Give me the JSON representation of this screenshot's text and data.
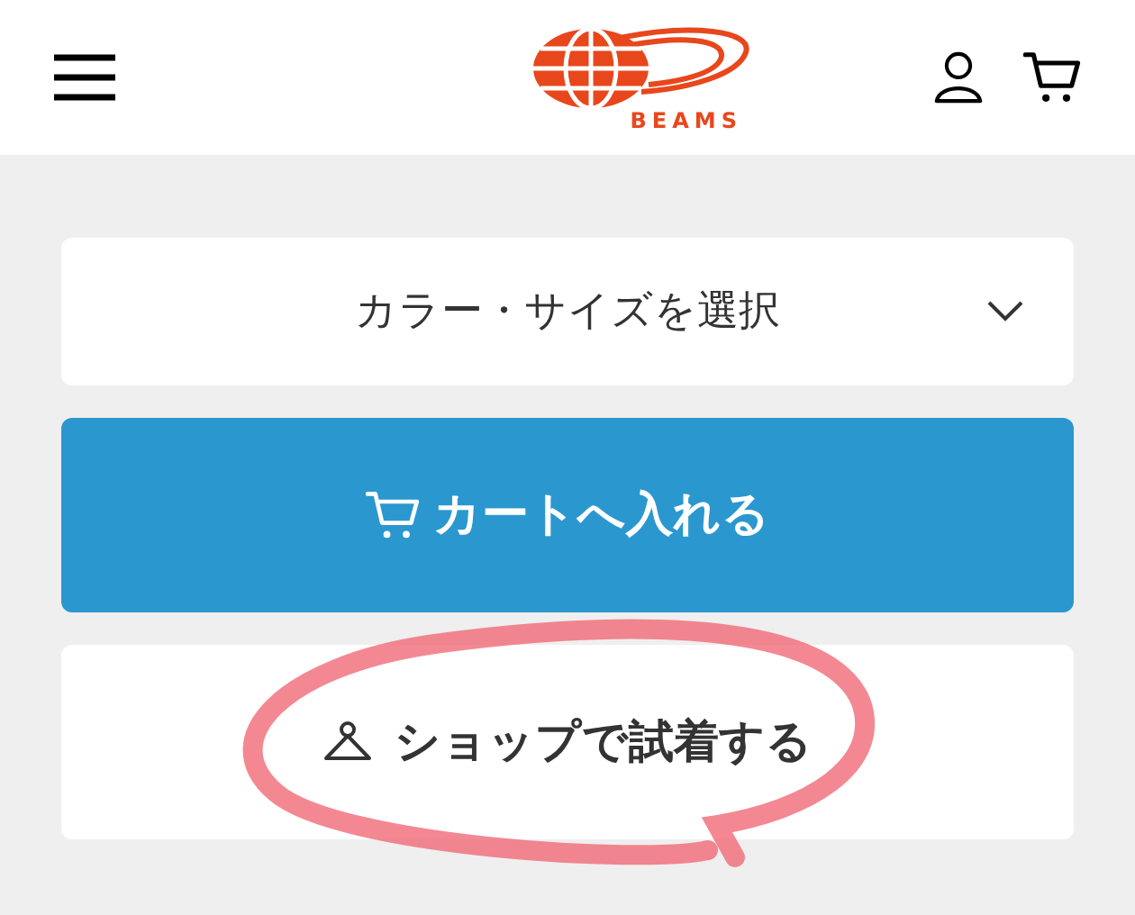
{
  "header": {
    "logo_text": "BEAMS"
  },
  "selector": {
    "label": "カラー・サイズを選択"
  },
  "buttons": [
    {
      "label": "カートへ入れる",
      "kind": "primary"
    },
    {
      "label": "ショップで試着する",
      "kind": "secondary"
    }
  ]
}
